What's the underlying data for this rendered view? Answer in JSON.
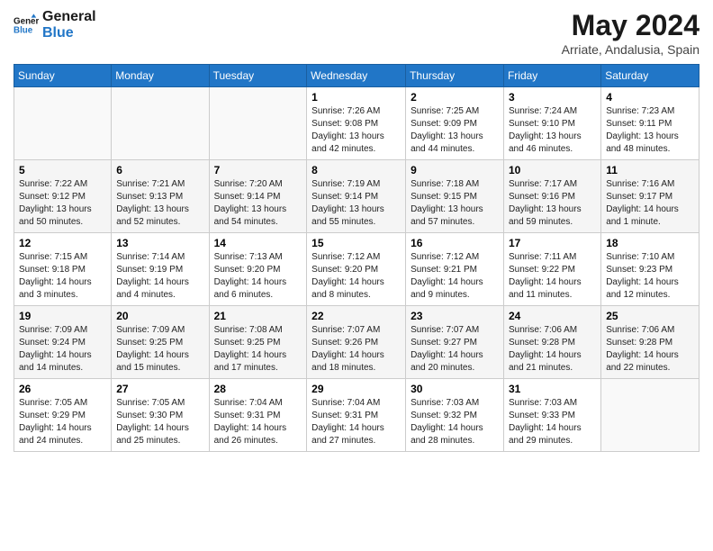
{
  "header": {
    "logo_line1": "General",
    "logo_line2": "Blue",
    "month_title": "May 2024",
    "location": "Arriate, Andalusia, Spain"
  },
  "weekdays": [
    "Sunday",
    "Monday",
    "Tuesday",
    "Wednesday",
    "Thursday",
    "Friday",
    "Saturday"
  ],
  "weeks": [
    [
      {
        "day": "",
        "sunrise": "",
        "sunset": "",
        "daylight": ""
      },
      {
        "day": "",
        "sunrise": "",
        "sunset": "",
        "daylight": ""
      },
      {
        "day": "",
        "sunrise": "",
        "sunset": "",
        "daylight": ""
      },
      {
        "day": "1",
        "sunrise": "7:26 AM",
        "sunset": "9:08 PM",
        "daylight": "13 hours and 42 minutes."
      },
      {
        "day": "2",
        "sunrise": "7:25 AM",
        "sunset": "9:09 PM",
        "daylight": "13 hours and 44 minutes."
      },
      {
        "day": "3",
        "sunrise": "7:24 AM",
        "sunset": "9:10 PM",
        "daylight": "13 hours and 46 minutes."
      },
      {
        "day": "4",
        "sunrise": "7:23 AM",
        "sunset": "9:11 PM",
        "daylight": "13 hours and 48 minutes."
      }
    ],
    [
      {
        "day": "5",
        "sunrise": "7:22 AM",
        "sunset": "9:12 PM",
        "daylight": "13 hours and 50 minutes."
      },
      {
        "day": "6",
        "sunrise": "7:21 AM",
        "sunset": "9:13 PM",
        "daylight": "13 hours and 52 minutes."
      },
      {
        "day": "7",
        "sunrise": "7:20 AM",
        "sunset": "9:14 PM",
        "daylight": "13 hours and 54 minutes."
      },
      {
        "day": "8",
        "sunrise": "7:19 AM",
        "sunset": "9:14 PM",
        "daylight": "13 hours and 55 minutes."
      },
      {
        "day": "9",
        "sunrise": "7:18 AM",
        "sunset": "9:15 PM",
        "daylight": "13 hours and 57 minutes."
      },
      {
        "day": "10",
        "sunrise": "7:17 AM",
        "sunset": "9:16 PM",
        "daylight": "13 hours and 59 minutes."
      },
      {
        "day": "11",
        "sunrise": "7:16 AM",
        "sunset": "9:17 PM",
        "daylight": "14 hours and 1 minute."
      }
    ],
    [
      {
        "day": "12",
        "sunrise": "7:15 AM",
        "sunset": "9:18 PM",
        "daylight": "14 hours and 3 minutes."
      },
      {
        "day": "13",
        "sunrise": "7:14 AM",
        "sunset": "9:19 PM",
        "daylight": "14 hours and 4 minutes."
      },
      {
        "day": "14",
        "sunrise": "7:13 AM",
        "sunset": "9:20 PM",
        "daylight": "14 hours and 6 minutes."
      },
      {
        "day": "15",
        "sunrise": "7:12 AM",
        "sunset": "9:20 PM",
        "daylight": "14 hours and 8 minutes."
      },
      {
        "day": "16",
        "sunrise": "7:12 AM",
        "sunset": "9:21 PM",
        "daylight": "14 hours and 9 minutes."
      },
      {
        "day": "17",
        "sunrise": "7:11 AM",
        "sunset": "9:22 PM",
        "daylight": "14 hours and 11 minutes."
      },
      {
        "day": "18",
        "sunrise": "7:10 AM",
        "sunset": "9:23 PM",
        "daylight": "14 hours and 12 minutes."
      }
    ],
    [
      {
        "day": "19",
        "sunrise": "7:09 AM",
        "sunset": "9:24 PM",
        "daylight": "14 hours and 14 minutes."
      },
      {
        "day": "20",
        "sunrise": "7:09 AM",
        "sunset": "9:25 PM",
        "daylight": "14 hours and 15 minutes."
      },
      {
        "day": "21",
        "sunrise": "7:08 AM",
        "sunset": "9:25 PM",
        "daylight": "14 hours and 17 minutes."
      },
      {
        "day": "22",
        "sunrise": "7:07 AM",
        "sunset": "9:26 PM",
        "daylight": "14 hours and 18 minutes."
      },
      {
        "day": "23",
        "sunrise": "7:07 AM",
        "sunset": "9:27 PM",
        "daylight": "14 hours and 20 minutes."
      },
      {
        "day": "24",
        "sunrise": "7:06 AM",
        "sunset": "9:28 PM",
        "daylight": "14 hours and 21 minutes."
      },
      {
        "day": "25",
        "sunrise": "7:06 AM",
        "sunset": "9:28 PM",
        "daylight": "14 hours and 22 minutes."
      }
    ],
    [
      {
        "day": "26",
        "sunrise": "7:05 AM",
        "sunset": "9:29 PM",
        "daylight": "14 hours and 24 minutes."
      },
      {
        "day": "27",
        "sunrise": "7:05 AM",
        "sunset": "9:30 PM",
        "daylight": "14 hours and 25 minutes."
      },
      {
        "day": "28",
        "sunrise": "7:04 AM",
        "sunset": "9:31 PM",
        "daylight": "14 hours and 26 minutes."
      },
      {
        "day": "29",
        "sunrise": "7:04 AM",
        "sunset": "9:31 PM",
        "daylight": "14 hours and 27 minutes."
      },
      {
        "day": "30",
        "sunrise": "7:03 AM",
        "sunset": "9:32 PM",
        "daylight": "14 hours and 28 minutes."
      },
      {
        "day": "31",
        "sunrise": "7:03 AM",
        "sunset": "9:33 PM",
        "daylight": "14 hours and 29 minutes."
      },
      {
        "day": "",
        "sunrise": "",
        "sunset": "",
        "daylight": ""
      }
    ]
  ],
  "labels": {
    "sunrise": "Sunrise:",
    "sunset": "Sunset:",
    "daylight": "Daylight:"
  }
}
